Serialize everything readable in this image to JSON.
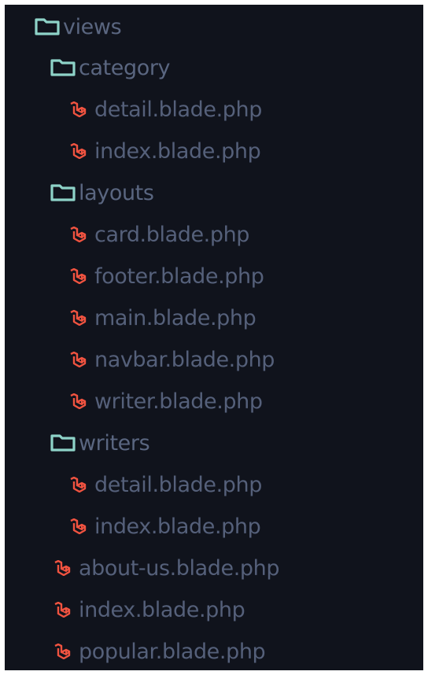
{
  "colors": {
    "background": "#10131c",
    "folder_icon": "#8ed3c8",
    "file_icon": "#f05340",
    "label_text": "#55607a"
  },
  "tree": [
    {
      "name": "views",
      "type": "folder",
      "depth": 0,
      "icon": "folder-icon"
    },
    {
      "name": "category",
      "type": "folder",
      "depth": 1,
      "icon": "folder-icon"
    },
    {
      "name": "detail.blade.php",
      "type": "file",
      "depth": 2,
      "icon": "laravel-blade-icon"
    },
    {
      "name": "index.blade.php",
      "type": "file",
      "depth": 2,
      "icon": "laravel-blade-icon"
    },
    {
      "name": "layouts",
      "type": "folder",
      "depth": 1,
      "icon": "folder-icon"
    },
    {
      "name": "card.blade.php",
      "type": "file",
      "depth": 2,
      "icon": "laravel-blade-icon"
    },
    {
      "name": "footer.blade.php",
      "type": "file",
      "depth": 2,
      "icon": "laravel-blade-icon"
    },
    {
      "name": "main.blade.php",
      "type": "file",
      "depth": 2,
      "icon": "laravel-blade-icon"
    },
    {
      "name": "navbar.blade.php",
      "type": "file",
      "depth": 2,
      "icon": "laravel-blade-icon"
    },
    {
      "name": "writer.blade.php",
      "type": "file",
      "depth": 2,
      "icon": "laravel-blade-icon"
    },
    {
      "name": "writers",
      "type": "folder",
      "depth": 1,
      "icon": "folder-icon"
    },
    {
      "name": "detail.blade.php",
      "type": "file",
      "depth": 2,
      "icon": "laravel-blade-icon"
    },
    {
      "name": "index.blade.php",
      "type": "file",
      "depth": 2,
      "icon": "laravel-blade-icon"
    },
    {
      "name": "about-us.blade.php",
      "type": "file",
      "depth": 1,
      "icon": "laravel-blade-icon"
    },
    {
      "name": "index.blade.php",
      "type": "file",
      "depth": 1,
      "icon": "laravel-blade-icon"
    },
    {
      "name": "popular.blade.php",
      "type": "file",
      "depth": 1,
      "icon": "laravel-blade-icon"
    }
  ]
}
